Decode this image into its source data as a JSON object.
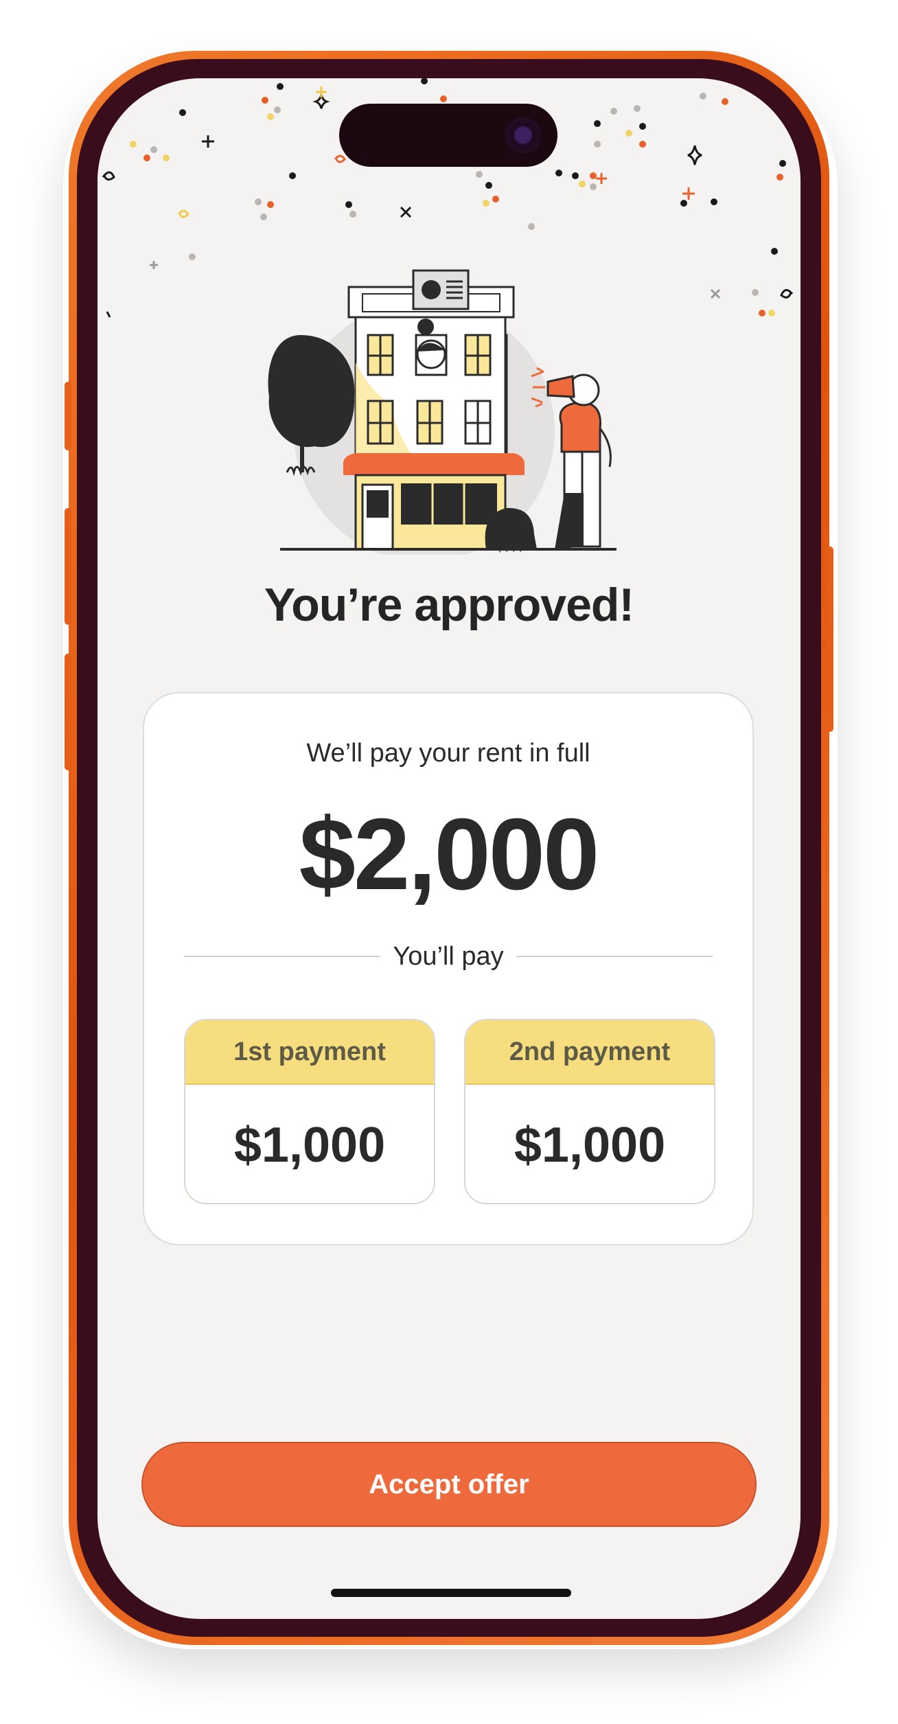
{
  "colors": {
    "frame": "#e8611c",
    "accent": "#ee6a3d",
    "highlight": "#f6de7e",
    "text": "#2a2a2a",
    "background": "#f4f3f2"
  },
  "header": {
    "title": "You’re approved!"
  },
  "offer": {
    "subtitle": "We’ll pay your rent in full",
    "amount": "$2,000",
    "divider_label": "You’ll pay",
    "payments": [
      {
        "label": "1st payment",
        "amount": "$1,000"
      },
      {
        "label": "2nd payment",
        "amount": "$1,000"
      }
    ]
  },
  "actions": {
    "accept_label": "Accept offer"
  },
  "icons": {
    "illustration": "apartment-building-celebration-illustration",
    "confetti": "confetti-icon"
  }
}
